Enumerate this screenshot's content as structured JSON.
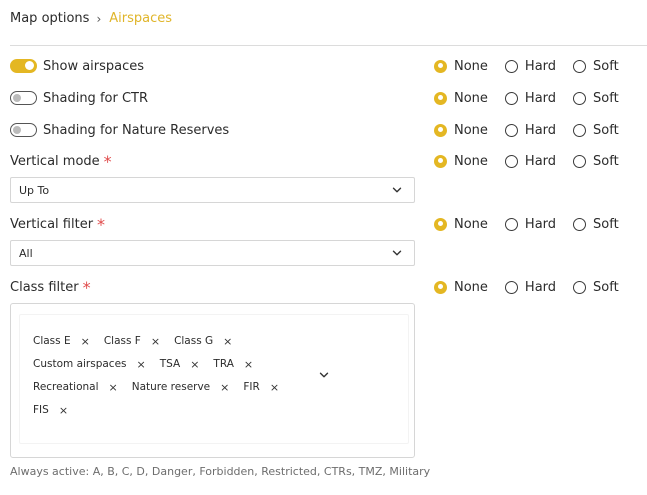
{
  "breadcrumb": {
    "parent": "Map options",
    "current": "Airspaces"
  },
  "radio_labels": {
    "none": "None",
    "hard": "Hard",
    "soft": "Soft"
  },
  "rows": [
    {
      "label": "Show airspaces",
      "toggle": "on",
      "selected": "none"
    },
    {
      "label": "Shading for CTR",
      "toggle": "off",
      "selected": "none"
    },
    {
      "label": "Shading for Nature Reserves",
      "toggle": "off",
      "selected": "none"
    },
    {
      "label": "Vertical mode",
      "required": "*",
      "selected": "none"
    },
    {
      "label": "Vertical filter",
      "required": "*",
      "selected": "none"
    },
    {
      "label": "Class filter",
      "required": "*",
      "selected": "none"
    }
  ],
  "vertical_mode": {
    "value": "Up To"
  },
  "vertical_filter": {
    "value": "All"
  },
  "class_filter": {
    "chips": [
      "Class E",
      "Class F",
      "Class G",
      "Custom airspaces",
      "TSA",
      "TRA",
      "Recreational",
      "Nature reserve",
      "FIR",
      "FIS"
    ],
    "remove_glyph": "×"
  },
  "footnote": "Always active: A, B, C, D, Danger, Forbidden, Restricted, CTRs, TMZ, Military",
  "colors": {
    "accent": "#e4b723",
    "required": "#e04a4a",
    "breadcrumb_current": "#e0b52a"
  },
  "icons": {
    "breadcrumb_separator": "chevron-right-icon",
    "select_arrow": "chevron-down-icon",
    "chip_remove": "close-icon"
  }
}
